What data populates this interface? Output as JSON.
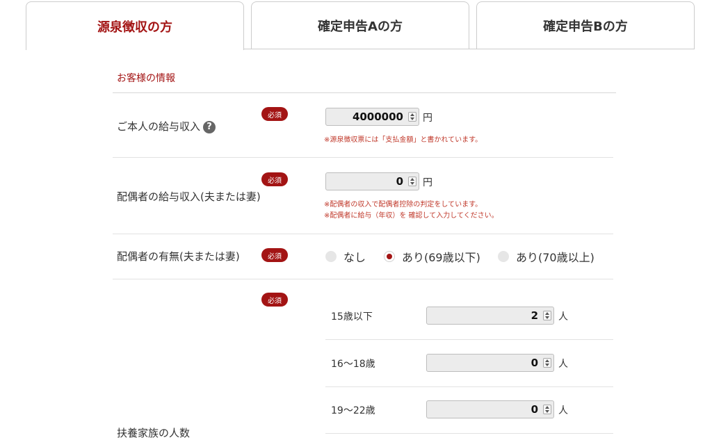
{
  "tabs": [
    {
      "label": "源泉徴収の方",
      "active": true
    },
    {
      "label": "確定申告Aの方",
      "active": false
    },
    {
      "label": "確定申告Bの方",
      "active": false
    }
  ],
  "section_title": "お客様の情報",
  "required_label": "必須",
  "help_icon": "?",
  "fields": {
    "salary": {
      "label": "ご本人の給与収入",
      "value": "4000000",
      "unit": "円",
      "note": "※源泉徴収票には「支払金額」と書かれています。"
    },
    "spouse_salary": {
      "label": "配偶者の給与収入(夫または妻)",
      "value": "0",
      "unit": "円",
      "notes": [
        "※配偶者の収入で配偶者控除の判定をしています。",
        "※配偶者に給与（年収）を 確認して入力してください。"
      ]
    },
    "spouse_presence": {
      "label": "配偶者の有無(夫または妻)",
      "options": [
        "なし",
        "あり(69歳以下)",
        "あり(70歳以上)"
      ],
      "selected": "あり(69歳以下)"
    },
    "dependents": {
      "label": "扶養家族の人数",
      "unit": "人",
      "rows": [
        {
          "label": "15歳以下",
          "value": "2"
        },
        {
          "label": "16〜18歳",
          "value": "0"
        },
        {
          "label": "19〜22歳",
          "value": "0"
        }
      ]
    }
  },
  "colors": {
    "accent": "#a31414",
    "note": "#c0392b",
    "input_bg": "#ececec",
    "border": "#cccccc"
  }
}
